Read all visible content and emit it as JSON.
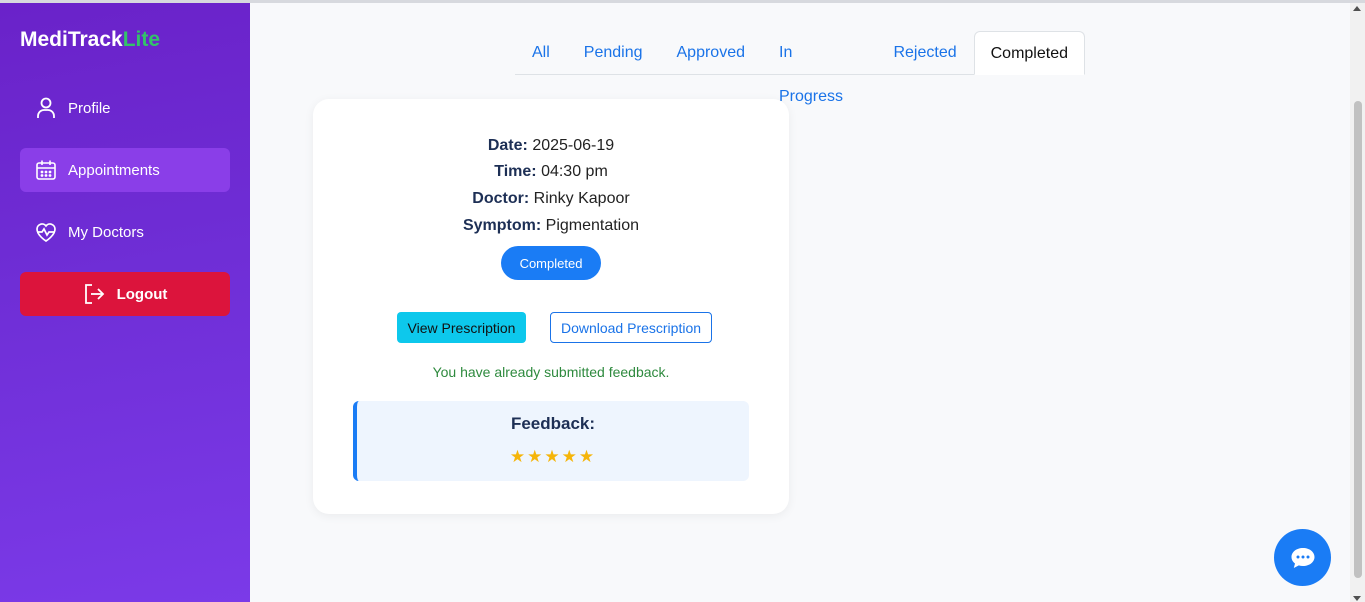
{
  "brand": {
    "name_main": "MediTrack",
    "name_accent": "Lite"
  },
  "sidebar": {
    "items": [
      {
        "label": "Profile",
        "icon": "user-icon"
      },
      {
        "label": "Appointments",
        "icon": "calendar-icon"
      },
      {
        "label": "My Doctors",
        "icon": "heart-pulse-icon"
      }
    ],
    "logout_label": "Logout"
  },
  "tabs": [
    "All",
    "Pending",
    "Approved",
    "In Progress",
    "Rejected",
    "Completed"
  ],
  "active_tab": "Completed",
  "appointment": {
    "date_label": "Date:",
    "date": "2025-06-19",
    "time_label": "Time:",
    "time": "04:30 pm",
    "doctor_label": "Doctor:",
    "doctor": "Rinky Kapoor",
    "symptom_label": "Symptom:",
    "symptom": "Pigmentation",
    "status": "Completed",
    "view_button": "View Prescription",
    "download_button": "Download Prescription",
    "feedback_note": "You have already submitted feedback.",
    "feedback_title": "Feedback:",
    "rating": 5,
    "stars": "★★★★★"
  },
  "colors": {
    "sidebar": "#6f2ed6",
    "accent": "#33c26a",
    "logout": "#dc143c",
    "primary": "#1a7cf5"
  }
}
